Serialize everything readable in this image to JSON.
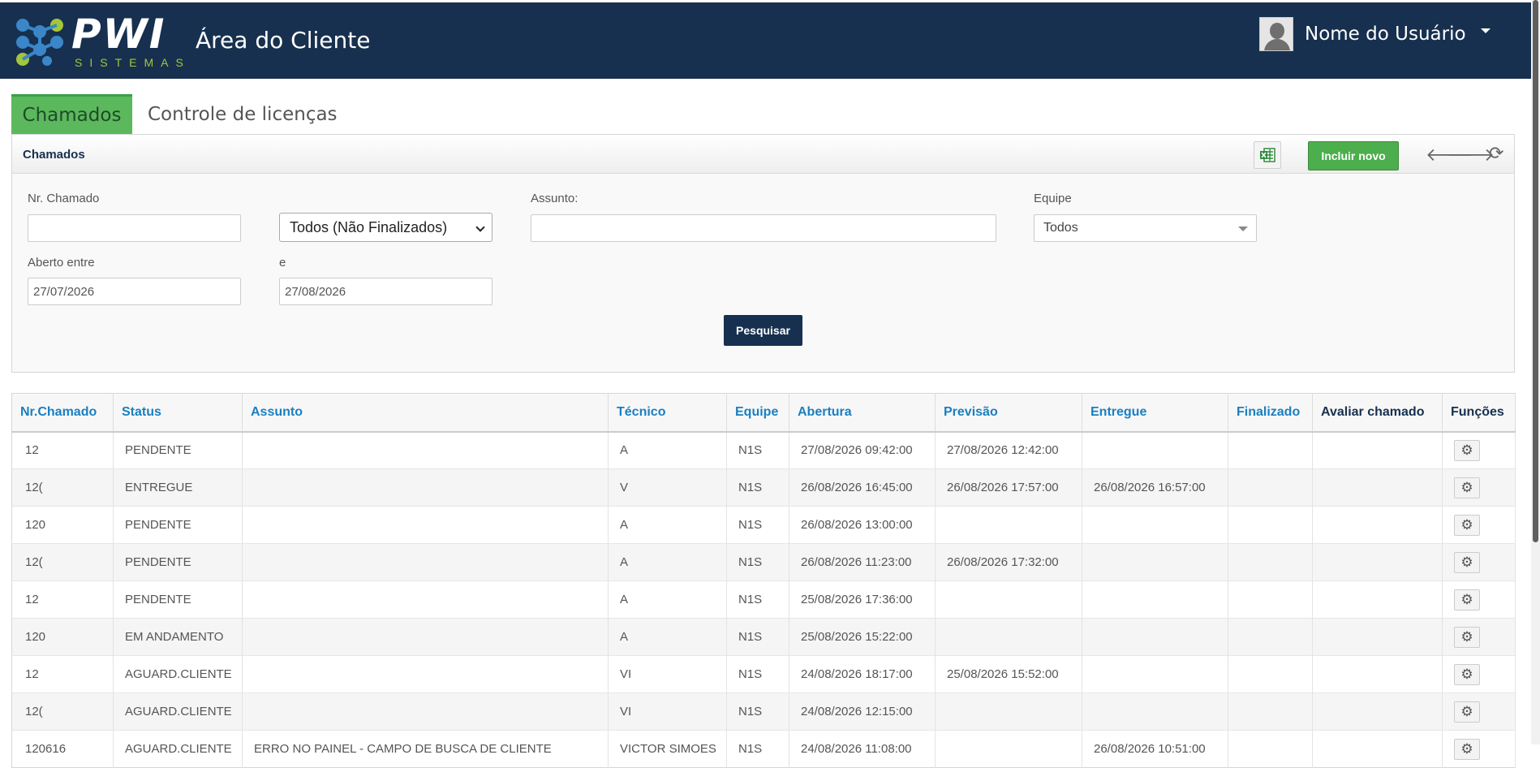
{
  "header": {
    "logo_text": "PWI",
    "logo_sub": "SISTEMAS",
    "app_title": "Área do Cliente",
    "user_name": "Nome do Usuário"
  },
  "tabs": [
    {
      "label": "Chamados",
      "active": true
    },
    {
      "label": "Controle de licenças",
      "active": false
    }
  ],
  "panel": {
    "title": "Chamados",
    "new_button": "Incluir novo",
    "search_button": "Pesquisar"
  },
  "filters": {
    "nr_label": "Nr. Chamado",
    "nr_value": "",
    "status_value": "Todos (Não Finalizados)",
    "subject_label": "Assunto:",
    "subject_value": "",
    "team_label": "Equipe",
    "team_value": "Todos",
    "opened_label": "Aberto entre",
    "and_label": "e",
    "date_from": "27/07/2026",
    "date_to": "27/08/2026"
  },
  "table": {
    "columns": [
      "Nr.Chamado",
      "Status",
      "Assunto",
      "Técnico",
      "Equipe",
      "Abertura",
      "Previsão",
      "Entregue",
      "Finalizado",
      "Avaliar chamado",
      "Funções"
    ],
    "rows": [
      [
        "12",
        "PENDENTE",
        "",
        "A",
        "N1S",
        "27/08/2026 09:42:00",
        "27/08/2026 12:42:00",
        "",
        "",
        ""
      ],
      [
        "12(",
        "ENTREGUE",
        "",
        "V",
        "N1S",
        "26/08/2026 16:45:00",
        "26/08/2026 17:57:00",
        "26/08/2026 16:57:00",
        "",
        ""
      ],
      [
        "120",
        "PENDENTE",
        "",
        "A",
        "N1S",
        "26/08/2026 13:00:00",
        "",
        "",
        "",
        ""
      ],
      [
        "12(",
        "PENDENTE",
        "",
        "A",
        "N1S",
        "26/08/2026 11:23:00",
        "26/08/2026 17:32:00",
        "",
        "",
        ""
      ],
      [
        "12",
        "PENDENTE",
        "",
        "A",
        "N1S",
        "25/08/2026 17:36:00",
        "",
        "",
        "",
        ""
      ],
      [
        "120",
        "EM ANDAMENTO",
        "",
        "A",
        "N1S",
        "25/08/2026 15:22:00",
        "",
        "",
        "",
        ""
      ],
      [
        "12",
        "AGUARD.CLIENTE",
        "",
        "VI",
        "N1S",
        "24/08/2026 18:17:00",
        "25/08/2026 15:52:00",
        "",
        "",
        ""
      ],
      [
        "12(",
        "AGUARD.CLIENTE",
        "",
        "VI",
        "N1S",
        "24/08/2026 12:15:00",
        "",
        "",
        "",
        ""
      ],
      [
        "120616",
        "AGUARD.CLIENTE",
        "ERRO NO PAINEL - CAMPO DE BUSCA DE CLIENTE",
        "VICTOR SIMOES",
        "N1S",
        "24/08/2026 11:08:00",
        "",
        "26/08/2026 10:51:00",
        "",
        ""
      ]
    ]
  },
  "colors": {
    "header_bg": "#17304f",
    "tab_active": "#5cb85c",
    "new_button": "#4cae4c",
    "column_link": "#1a7fc1"
  },
  "icons": [
    "excel-icon",
    "arrow-left-icon",
    "arrow-right-icon",
    "refresh-icon",
    "gear-icon",
    "caret-down-icon",
    "avatar"
  ]
}
